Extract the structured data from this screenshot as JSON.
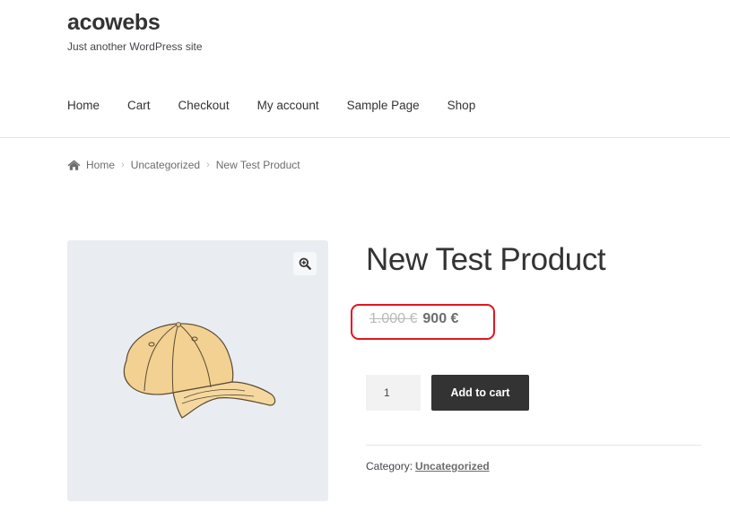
{
  "site": {
    "title": "acowebs",
    "tagline": "Just another WordPress site"
  },
  "nav": {
    "items": [
      {
        "label": "Home"
      },
      {
        "label": "Cart"
      },
      {
        "label": "Checkout"
      },
      {
        "label": "My account"
      },
      {
        "label": "Sample Page"
      },
      {
        "label": "Shop"
      }
    ]
  },
  "breadcrumb": {
    "home": "Home",
    "category": "Uncategorized",
    "current": "New Test Product",
    "icon": "home-icon"
  },
  "product": {
    "title": "New Test Product",
    "image_icon": "baseball-cap-illustration",
    "zoom_icon": "zoom-in-icon",
    "price_old": "1.000 €",
    "price_new": "900 €",
    "quantity": "1",
    "add_to_cart_label": "Add to cart",
    "category_label": "Category:",
    "category_value": "Uncategorized"
  },
  "colors": {
    "highlight_border": "#e5141e",
    "button_bg": "#333333",
    "image_bg": "#e9edf1",
    "cap_fill": "#f2d192"
  }
}
